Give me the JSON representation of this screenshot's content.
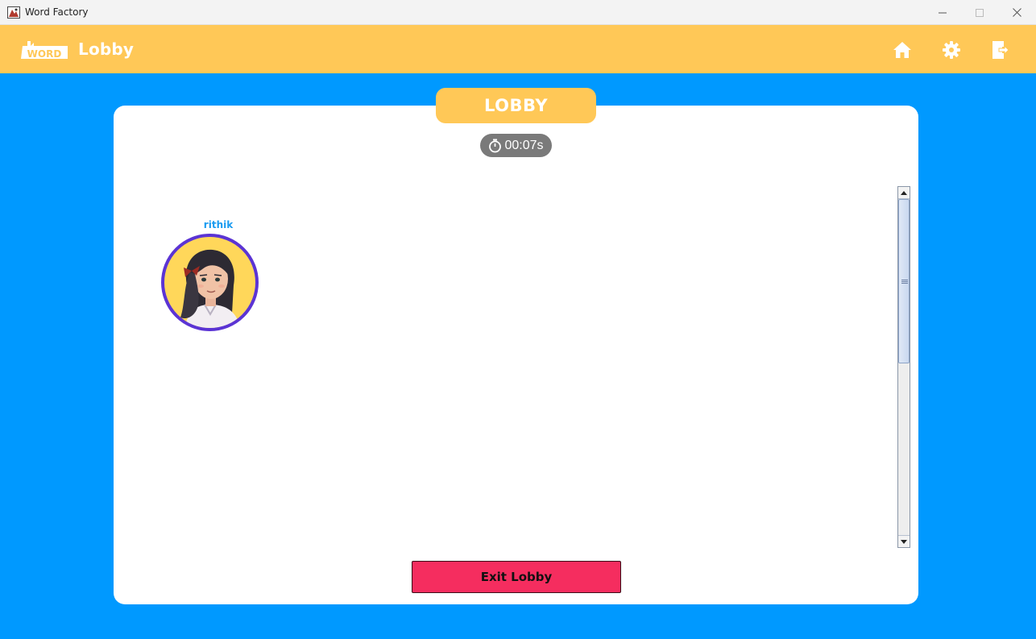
{
  "window": {
    "title": "Word Factory",
    "controls": [
      "minimize-icon",
      "maximize-icon",
      "close-icon"
    ]
  },
  "header": {
    "logo_text": "WORD",
    "title": "Lobby",
    "icons": [
      "home-icon",
      "gear-icon",
      "exit-door-icon"
    ],
    "background": "#ffc857"
  },
  "lobby": {
    "banner": "LOBBY",
    "timer": "00:07s",
    "players": [
      {
        "name": "rithik",
        "avatar": "girl-avatar"
      }
    ],
    "exit_button": "Exit Lobby"
  },
  "colors": {
    "page_bg": "#0099ff",
    "accent": "#ffc857",
    "exit_button": "#f52d5f",
    "avatar_ring": "#5b34d4",
    "avatar_bg": "#ffd75a",
    "player_name": "#1a9bf0"
  }
}
